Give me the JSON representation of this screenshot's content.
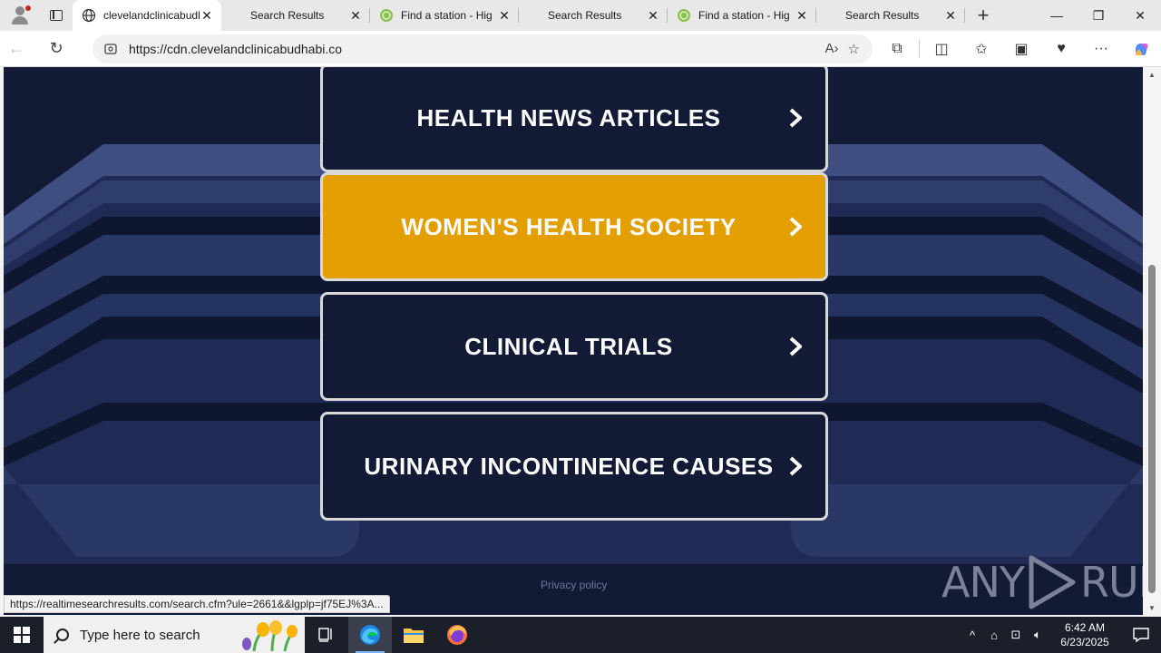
{
  "browser": {
    "tabs": [
      {
        "title": "clevelandclinicabudhabi.co",
        "favicon": "globe-icon",
        "active": true
      },
      {
        "title": "Search Results",
        "favicon": "",
        "active": false
      },
      {
        "title": "Find a station - Hig",
        "favicon": "station-icon",
        "active": false
      },
      {
        "title": "Search Results",
        "favicon": "",
        "active": false
      },
      {
        "title": "Find a station - Hig",
        "favicon": "station-icon",
        "active": false
      },
      {
        "title": "Search Results",
        "favicon": "",
        "active": false
      }
    ],
    "url": "https://cdn.clevelandclinicabudhabi.co"
  },
  "page": {
    "buttons": [
      {
        "label": "HEALTH NEWS ARTICLES",
        "highlighted": false
      },
      {
        "label": "WOMEN'S HEALTH SOCIETY",
        "highlighted": true
      },
      {
        "label": "CLINICAL TRIALS",
        "highlighted": false
      },
      {
        "label": "URINARY INCONTINENCE CAUSES",
        "highlighted": false
      }
    ],
    "privacy": "Privacy policy",
    "watermark": "ANY RUN",
    "status_url": "https://realtimesearchresults.com/search.cfm?ule=2661&&lgplp=jf75EJ%3A...",
    "colors": {
      "background": "#131a36",
      "highlight": "#e39e00",
      "border": "#d9d9d9"
    }
  },
  "taskbar": {
    "search_placeholder": "Type here to search",
    "time": "6:42 AM",
    "date": "6/23/2025"
  }
}
